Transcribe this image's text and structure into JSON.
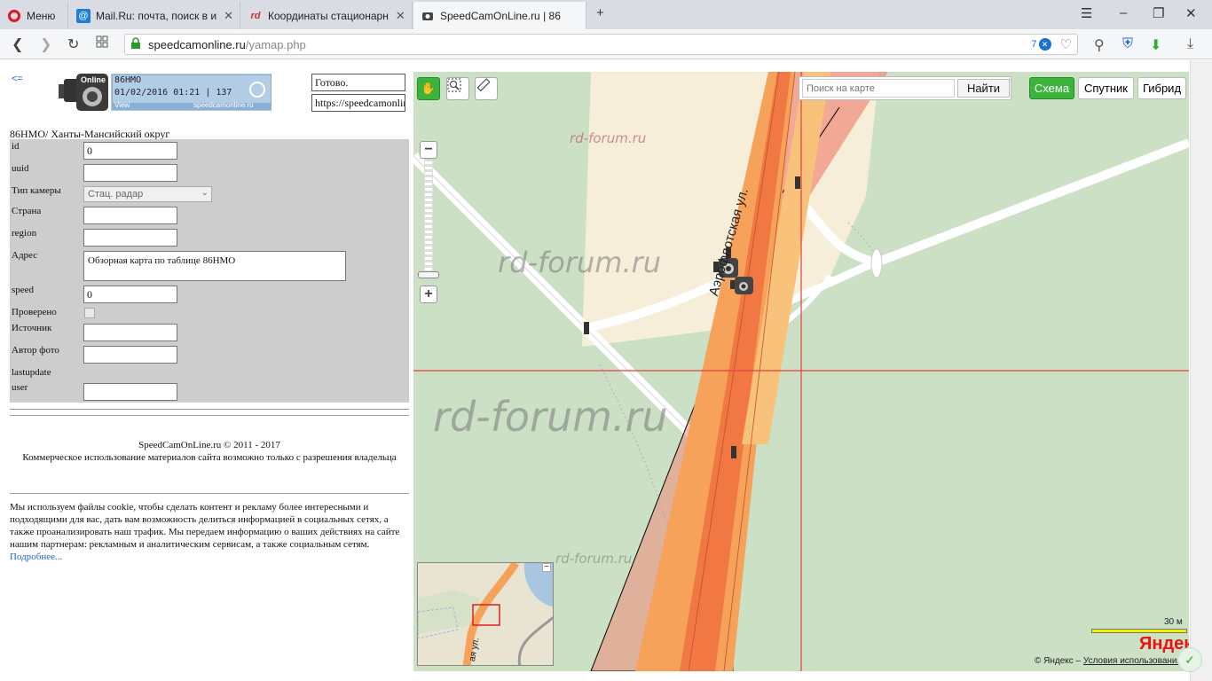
{
  "browser": {
    "menu_label": "Меню",
    "tabs": [
      {
        "title": "Mail.Ru: почта, поиск в и",
        "favicon": "@"
      },
      {
        "title": "Координаты стационарн",
        "favicon": "rd"
      },
      {
        "title": "SpeedCamOnLine.ru | 86",
        "favicon": "cam"
      }
    ],
    "url_host": "speedcamonline.ru",
    "url_path": "/yamap.php",
    "badge_count": "7"
  },
  "left": {
    "back_link": "<=",
    "banner": {
      "code": "86HMO",
      "date_line": "01/02/2016 01:21 | 137",
      "view_label": "View",
      "site": "speedcamonline.ru",
      "online_label": "Online"
    },
    "status_value": "Готово.",
    "url_value": "https://speedcamonline.ru/",
    "region_title": "86НМО/ Ханты-Мансийский округ",
    "form": {
      "id_label": "id",
      "id_value": "0",
      "uuid_label": "uuid",
      "uuid_value": "",
      "camtype_label": "Тип камеры",
      "camtype_value": "Стац. радар",
      "country_label": "Страна",
      "country_value": "",
      "region_label": "region",
      "region_value": "",
      "address_label": "Адрес",
      "address_value": "Обзорная карта по таблице 86НМО",
      "speed_label": "speed",
      "speed_value": "0",
      "verified_label": "Проверено",
      "source_label": "Источник",
      "source_value": "",
      "author_label": "Автор фото",
      "author_value": "",
      "lastupdate_label": "lastupdate",
      "user_label": "user",
      "user_value": ""
    },
    "footer_line1": "SpeedCamOnLine.ru © 2011 - 2017",
    "footer_line2": "Коммерческое использование материалов сайта возможно только с разрешения владельца",
    "cookie_text": "Мы используем файлы cookie, чтобы сделать контент и рекламу более интересными и подходящими для вас, дать вам возможность делиться информацией в социальных сетях, а также проанализировать наш трафик. Мы передаем информацию о ваших действиях на сайте нашим партнерам: рекламным и аналитическим сервисам, а также социальным сетям.",
    "cookie_link": "Подробнее..."
  },
  "map": {
    "search_placeholder": "Поиск на карте",
    "search_button": "Найти",
    "layers": {
      "scheme": "Схема",
      "satellite": "Спутник",
      "hybrid": "Гибрид"
    },
    "street_name": "Аэрофлотская ул.",
    "minimap_street": "ая ул.",
    "scale_label": "30 м",
    "logo": "Яндекс",
    "copyright_prefix": "© Яндекс –",
    "copyright_link": "Условия использования",
    "watermark": "rd-forum.ru",
    "colors": {
      "active_layer": "#3cb43c",
      "tool_active": "#3cb43c",
      "radar_zone": "#f08a78"
    }
  }
}
